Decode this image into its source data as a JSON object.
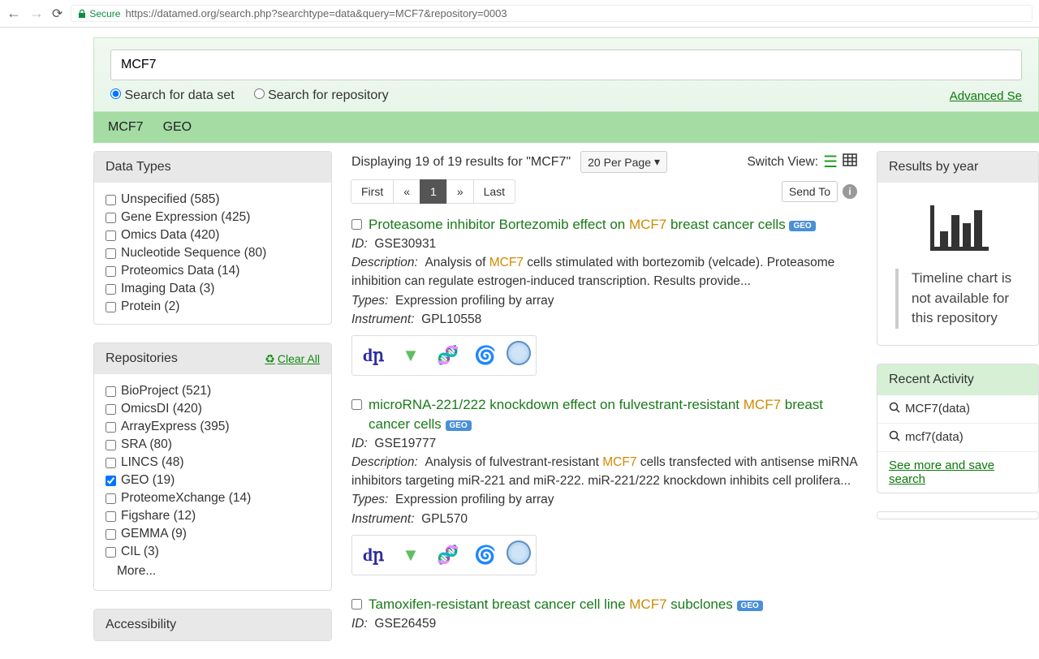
{
  "browser": {
    "secure_label": "Secure",
    "url_prefix": "https://",
    "url_domain": "datamed.org",
    "url_path": "/search.php?searchtype=data&query=MCF7&repository=0003"
  },
  "search": {
    "input_value": "MCF7",
    "radio_dataset": "Search for data set",
    "radio_repo": "Search for repository",
    "advanced": "Advanced Se"
  },
  "breadcrumb": {
    "term": "MCF7",
    "repo": "GEO"
  },
  "facets": {
    "types_header": "Data Types",
    "types": [
      {
        "label": "Unspecified (585)"
      },
      {
        "label": "Gene Expression (425)"
      },
      {
        "label": "Omics Data (420)"
      },
      {
        "label": "Nucleotide Sequence (80)"
      },
      {
        "label": "Proteomics Data (14)"
      },
      {
        "label": "Imaging Data (3)"
      },
      {
        "label": "Protein (2)"
      }
    ],
    "repos_header": "Repositories",
    "clear_all": "Clear All",
    "repos": [
      {
        "label": "BioProject (521)",
        "checked": false
      },
      {
        "label": "OmicsDI (420)",
        "checked": false
      },
      {
        "label": "ArrayExpress (395)",
        "checked": false
      },
      {
        "label": "SRA (80)",
        "checked": false
      },
      {
        "label": "LINCS (48)",
        "checked": false
      },
      {
        "label": "GEO (19)",
        "checked": true
      },
      {
        "label": "ProteomeXchange (14)",
        "checked": false
      },
      {
        "label": "Figshare (12)",
        "checked": false
      },
      {
        "label": "GEMMA (9)",
        "checked": false
      },
      {
        "label": "CIL (3)",
        "checked": false
      }
    ],
    "more": "More...",
    "access_header": "Accessibility"
  },
  "summary": {
    "text": "Displaying 19 of 19 results for \"MCF7\"",
    "per_page": "20 Per Page",
    "switch_label": "Switch View:"
  },
  "pager": {
    "first": "First",
    "prev": "«",
    "page": "1",
    "next": "»",
    "last": "Last"
  },
  "sendto": "Send To",
  "labels": {
    "id": "ID:",
    "desc": "Description:",
    "types": "Types:",
    "instr": "Instrument:"
  },
  "results": [
    {
      "title_pre": "Proteasome inhibitor Bortezomib effect on ",
      "title_hl": "MCF7",
      "title_post": " breast cancer cells",
      "badge": "GEO",
      "id": "GSE30931",
      "desc_pre": "Analysis of ",
      "desc_hl": "MCF7",
      "desc_post": " cells stimulated with bortezomib (velcade). Proteasome inhibition can regulate estrogen-induced transcription. Results provide...",
      "types": "Expression profiling by array",
      "instrument": "GPL10558"
    },
    {
      "title_pre": "microRNA-221/222 knockdown effect on fulvestrant-resistant ",
      "title_hl": "MCF7",
      "title_post": " breast cancer cells",
      "badge": "GEO",
      "id": "GSE19777",
      "desc_pre": "Analysis of fulvestrant-resistant ",
      "desc_hl": "MCF7",
      "desc_post": " cells transfected with antisense miRNA inhibitors targeting miR-221 and miR-222. miR-221/222 knockdown inhibits cell prolifera...",
      "types": "Expression profiling by array",
      "instrument": "GPL570"
    },
    {
      "title_pre": "Tamoxifen-resistant breast cancer cell line ",
      "title_hl": "MCF7",
      "title_post": " subclones",
      "badge": "GEO",
      "id": "GSE26459",
      "desc_pre": "",
      "desc_hl": "",
      "desc_post": "",
      "types": "",
      "instrument": ""
    }
  ],
  "right": {
    "year_header": "Results by year",
    "timeline_msg": "Timeline chart is not available for this repository",
    "recent_header": "Recent Activity",
    "recent": [
      {
        "label": "MCF7(data)"
      },
      {
        "label": "mcf7(data)"
      }
    ],
    "see_more": "See more and save search"
  }
}
